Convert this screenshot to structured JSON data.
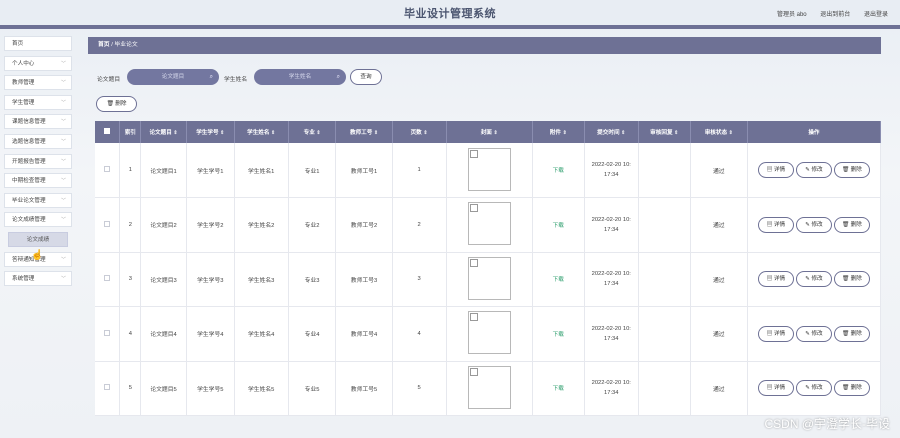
{
  "app": {
    "title": "毕业设计管理系统",
    "top_links": [
      "管理员 abo",
      "退出到前台",
      "退出登录"
    ]
  },
  "sidebar": {
    "items": [
      {
        "label": "首页",
        "chev": ""
      },
      {
        "label": "个人中心",
        "chev": "﹀"
      },
      {
        "label": "教师管理",
        "chev": "﹀"
      },
      {
        "label": "学生管理",
        "chev": "﹀"
      },
      {
        "label": "课题信息管理",
        "chev": "﹀"
      },
      {
        "label": "选题信息管理",
        "chev": "﹀"
      },
      {
        "label": "开题报告管理",
        "chev": "﹀"
      },
      {
        "label": "中期检查管理",
        "chev": "﹀"
      },
      {
        "label": "毕业论文管理",
        "chev": "﹀"
      },
      {
        "label": "论文成绩管理",
        "chev": "﹀"
      }
    ],
    "sub_item": "论文成绩",
    "items_after": [
      {
        "label": "答辩通知管理",
        "chev": "﹀"
      },
      {
        "label": "系统管理",
        "chev": "﹀"
      }
    ]
  },
  "breadcrumb": {
    "home": "首页",
    "sep": "/",
    "current": "毕业论文"
  },
  "search": {
    "label1": "论文题目",
    "placeholder1": "论文题目",
    "label2": "学生姓名",
    "placeholder2": "学生姓名",
    "query_button": "查询",
    "delete_button": "删除"
  },
  "table": {
    "headers": [
      "索引",
      "论文题目",
      "学生学号",
      "学生姓名",
      "专业",
      "教师工号",
      "页数",
      "封面",
      "附件",
      "提交时间",
      "审核回复",
      "审核状态",
      "操作"
    ],
    "rows": [
      {
        "idx": "1",
        "title": "论文题目1",
        "sno": "学生学号1",
        "sname": "学生姓名1",
        "major": "专业1",
        "tno": "教师工号1",
        "pages": "1",
        "file": "下载",
        "date": "2022-02-20 10:",
        "time": "17:34",
        "status": "通过"
      },
      {
        "idx": "2",
        "title": "论文题目2",
        "sno": "学生学号2",
        "sname": "学生姓名2",
        "major": "专业2",
        "tno": "教师工号2",
        "pages": "2",
        "file": "下载",
        "date": "2022-02-20 10:",
        "time": "17:34",
        "status": "通过"
      },
      {
        "idx": "3",
        "title": "论文题目3",
        "sno": "学生学号3",
        "sname": "学生姓名3",
        "major": "专业3",
        "tno": "教师工号3",
        "pages": "3",
        "file": "下载",
        "date": "2022-02-20 10:",
        "time": "17:34",
        "status": "通过"
      },
      {
        "idx": "4",
        "title": "论文题目4",
        "sno": "学生学号4",
        "sname": "学生姓名4",
        "major": "专业4",
        "tno": "教师工号4",
        "pages": "4",
        "file": "下载",
        "date": "2022-02-20 10:",
        "time": "17:34",
        "status": "通过"
      },
      {
        "idx": "5",
        "title": "论文题目5",
        "sno": "学生学号5",
        "sname": "学生姓名5",
        "major": "专业5",
        "tno": "教师工号5",
        "pages": "5",
        "file": "下载",
        "date": "2022-02-20 10:",
        "time": "17:34",
        "status": "通过"
      }
    ],
    "actions": {
      "detail": "详情",
      "edit": "修改",
      "delete": "删除"
    }
  },
  "icons": {
    "sort": "sort-caret-icon",
    "search": "search-icon",
    "trash": "trash-icon",
    "doc": "doc-icon",
    "pencil": "edit-icon"
  },
  "watermark": "CSDN @宇澄学长-毕设",
  "colors": {
    "accent": "#6e7195",
    "download": "#2a9d6b"
  }
}
